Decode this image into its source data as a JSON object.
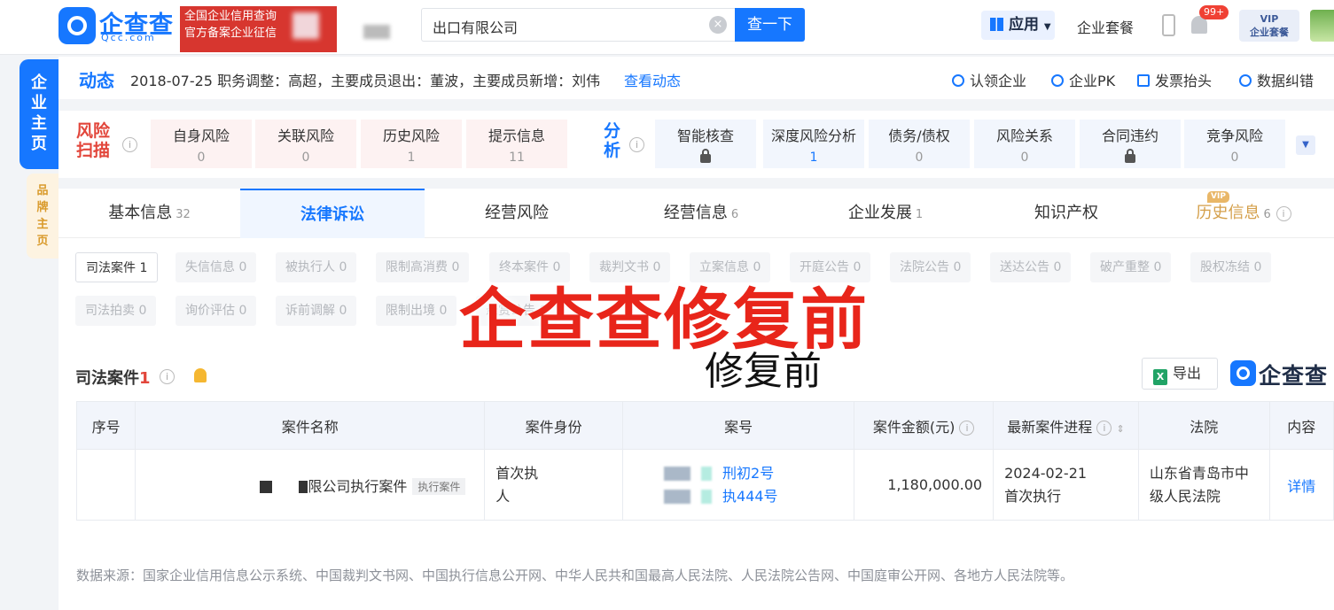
{
  "header": {
    "logo_text": "企查查",
    "logo_sub": "Qcc.com",
    "banner_line1": "全国企业信用查询",
    "banner_line2": "官方备案企业征信",
    "search_value": "出口有限公司",
    "search_button": "查一下",
    "app_button": "应用",
    "suite_link": "企业套餐",
    "notification_count": "99+",
    "vip_line1": "VIP",
    "vip_line2": "企业套餐"
  },
  "side_tabs": {
    "main": "企业主页",
    "brand": "品牌主页"
  },
  "dynamic": {
    "title": "动态",
    "text": "2018-07-25 职务调整：高超，主要成员退出：董波，主要成员新增：刘伟",
    "link": "查看动态",
    "actions": [
      "认领企业",
      "企业PK",
      "发票抬头",
      "数据纠错"
    ]
  },
  "risk_scan": {
    "label": "风险扫描",
    "items": [
      {
        "name": "自身风险",
        "value": "0"
      },
      {
        "name": "关联风险",
        "value": "0"
      },
      {
        "name": "历史风险",
        "value": "1"
      },
      {
        "name": "提示信息",
        "value": "11"
      }
    ]
  },
  "analysis": {
    "label": "分析",
    "items": [
      {
        "name": "智能核查",
        "value": ""
      },
      {
        "name": "深度风险分析",
        "value": "1"
      },
      {
        "name": "债务/债权",
        "value": "0"
      },
      {
        "name": "风险关系",
        "value": "0"
      },
      {
        "name": "合同违约",
        "value": ""
      },
      {
        "name": "竞争风险",
        "value": "0"
      }
    ]
  },
  "main_tabs": [
    {
      "label": "基本信息",
      "count": "32"
    },
    {
      "label": "法律诉讼",
      "count": ""
    },
    {
      "label": "经营风险",
      "count": ""
    },
    {
      "label": "经营信息",
      "count": "6"
    },
    {
      "label": "企业发展",
      "count": "1"
    },
    {
      "label": "知识产权",
      "count": ""
    },
    {
      "label": "历史信息",
      "count": "6"
    }
  ],
  "vip_tag": "VIP",
  "sub_tabs_row1": [
    "司法案件 1",
    "失信信息 0",
    "被执行人 0",
    "限制高消费 0",
    "终本案件 0",
    "裁判文书 0",
    "立案信息 0",
    "开庭公告 0",
    "法院公告 0",
    "送达公告 0",
    "破产重整 0",
    "股权冻结 0"
  ],
  "sub_tabs_row2": [
    "司法拍卖 0",
    "询价评估 0",
    "诉前调解 0",
    "限制出境 0",
    "悬赏公告 0"
  ],
  "watermark": {
    "big": "企查查修复前",
    "small": "修复前"
  },
  "section": {
    "title": "司法案件",
    "count": "1",
    "export": "导出",
    "brand": "企查查"
  },
  "table": {
    "headers": [
      "序号",
      "案件名称",
      "案件身份",
      "案号",
      "案件金额(元)",
      "最新案件进程",
      "法院",
      "内容"
    ],
    "row": {
      "name": "限公司执行案件",
      "tag": "执行案件",
      "role_line1": "首次执",
      "role_line2": "人",
      "case_no_1": "刑初2号",
      "case_no_2": "执444号",
      "amount": "1,180,000.00",
      "progress_date": "2024-02-21",
      "progress_stage": "首次执行",
      "court_line1": "山东省青岛市中",
      "court_line2": "级人民法院",
      "detail": "详情"
    }
  },
  "source_note": "数据来源：国家企业信用信息公示系统、中国裁判文书网、中国执行信息公开网、中华人民共和国最高人民法院、人民法院公告网、中国庭审公开网、各地方人民法院等。",
  "colors": {
    "brand_blue": "#1677ff",
    "risk_red": "#e2463b",
    "watermark_red": "#e8251a",
    "vip_gold": "#d49f4a"
  }
}
